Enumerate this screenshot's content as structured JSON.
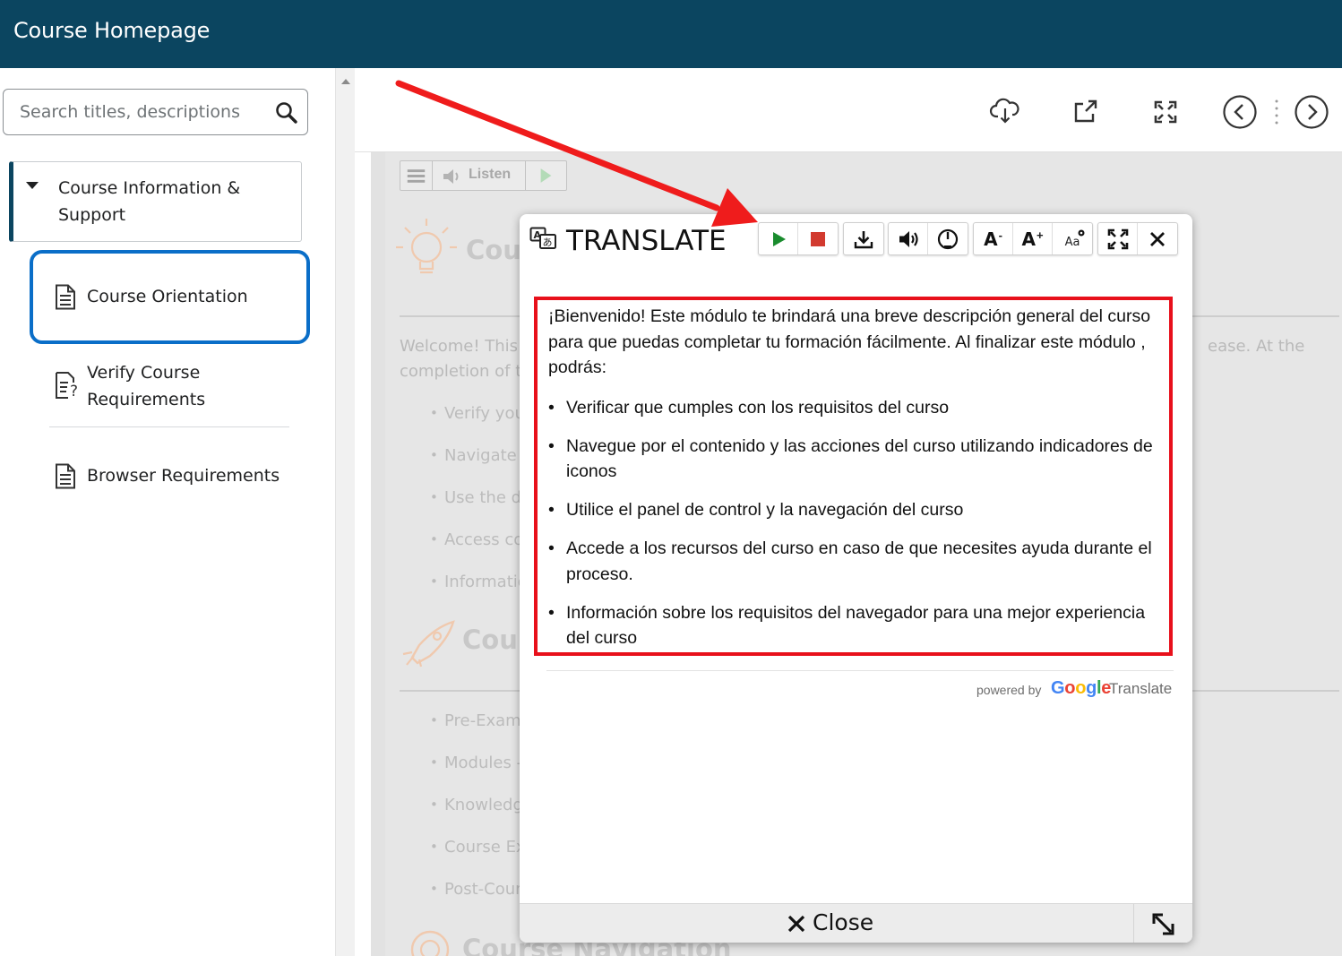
{
  "header": {
    "title": "Course Homepage"
  },
  "sidebar": {
    "search_placeholder": "Search titles, descriptions",
    "module_label": "Course Information & Support",
    "items": [
      {
        "label": "Course Orientation",
        "icon": "document-icon",
        "active": true
      },
      {
        "label": "Verify Course Requirements",
        "icon": "checklist-question-icon",
        "active": false
      },
      {
        "label": "Browser Requirements",
        "icon": "document-icon",
        "active": false
      }
    ]
  },
  "content_toolbar": {
    "icons": [
      "cloud-download-icon",
      "open-new-window-icon",
      "fullscreen-icon",
      "previous-icon",
      "next-icon"
    ]
  },
  "page": {
    "listen_label": "Listen",
    "section1_heading": "Cou",
    "para_left_line1": "Welcome! This mo",
    "para_left_line2": "completion of this",
    "para_right": "ease. At the",
    "bullets1": [
      "Verify you n",
      "Navigate th",
      "Use the das",
      "Access cour",
      "Information"
    ],
    "section2_heading": "Course",
    "bullets2": [
      "Pre-Exam - ",
      "Modules - Y",
      "Knowledge ",
      "Course Exar",
      "Post-Course"
    ],
    "section3_heading": "Course Navigation"
  },
  "translate": {
    "title": "TRANSLATE",
    "toolbar": {
      "font_decrease": "A",
      "font_increase": "A",
      "font_style": "Aa"
    },
    "intro": "¡Bienvenido! Este módulo te brindará una breve descripción general del curso para que puedas completar tu formación fácilmente. Al finalizar este módulo , podrás:",
    "items": [
      "Verificar que cumples con los requisitos del curso",
      "Navegue por el contenido y las acciones del curso utilizando indicadores de iconos",
      "Utilice el panel de control y la navegación del curso",
      "Accede a los recursos del curso en caso de que necesites ayuda durante el proceso.",
      "Información sobre los requisitos del navegador para una mejor experiencia del curso"
    ],
    "powered_by": "powered by",
    "google": "Google",
    "translate_word": "Translate",
    "close_label": "Close"
  },
  "colors": {
    "header_bg": "#0b4560",
    "active_outline": "#0a6ec8",
    "highlight_box": "#e8101b",
    "play_green": "#1a8c2e",
    "stop_red": "#d23a2f",
    "annotation_arrow": "#ef1c1c"
  }
}
